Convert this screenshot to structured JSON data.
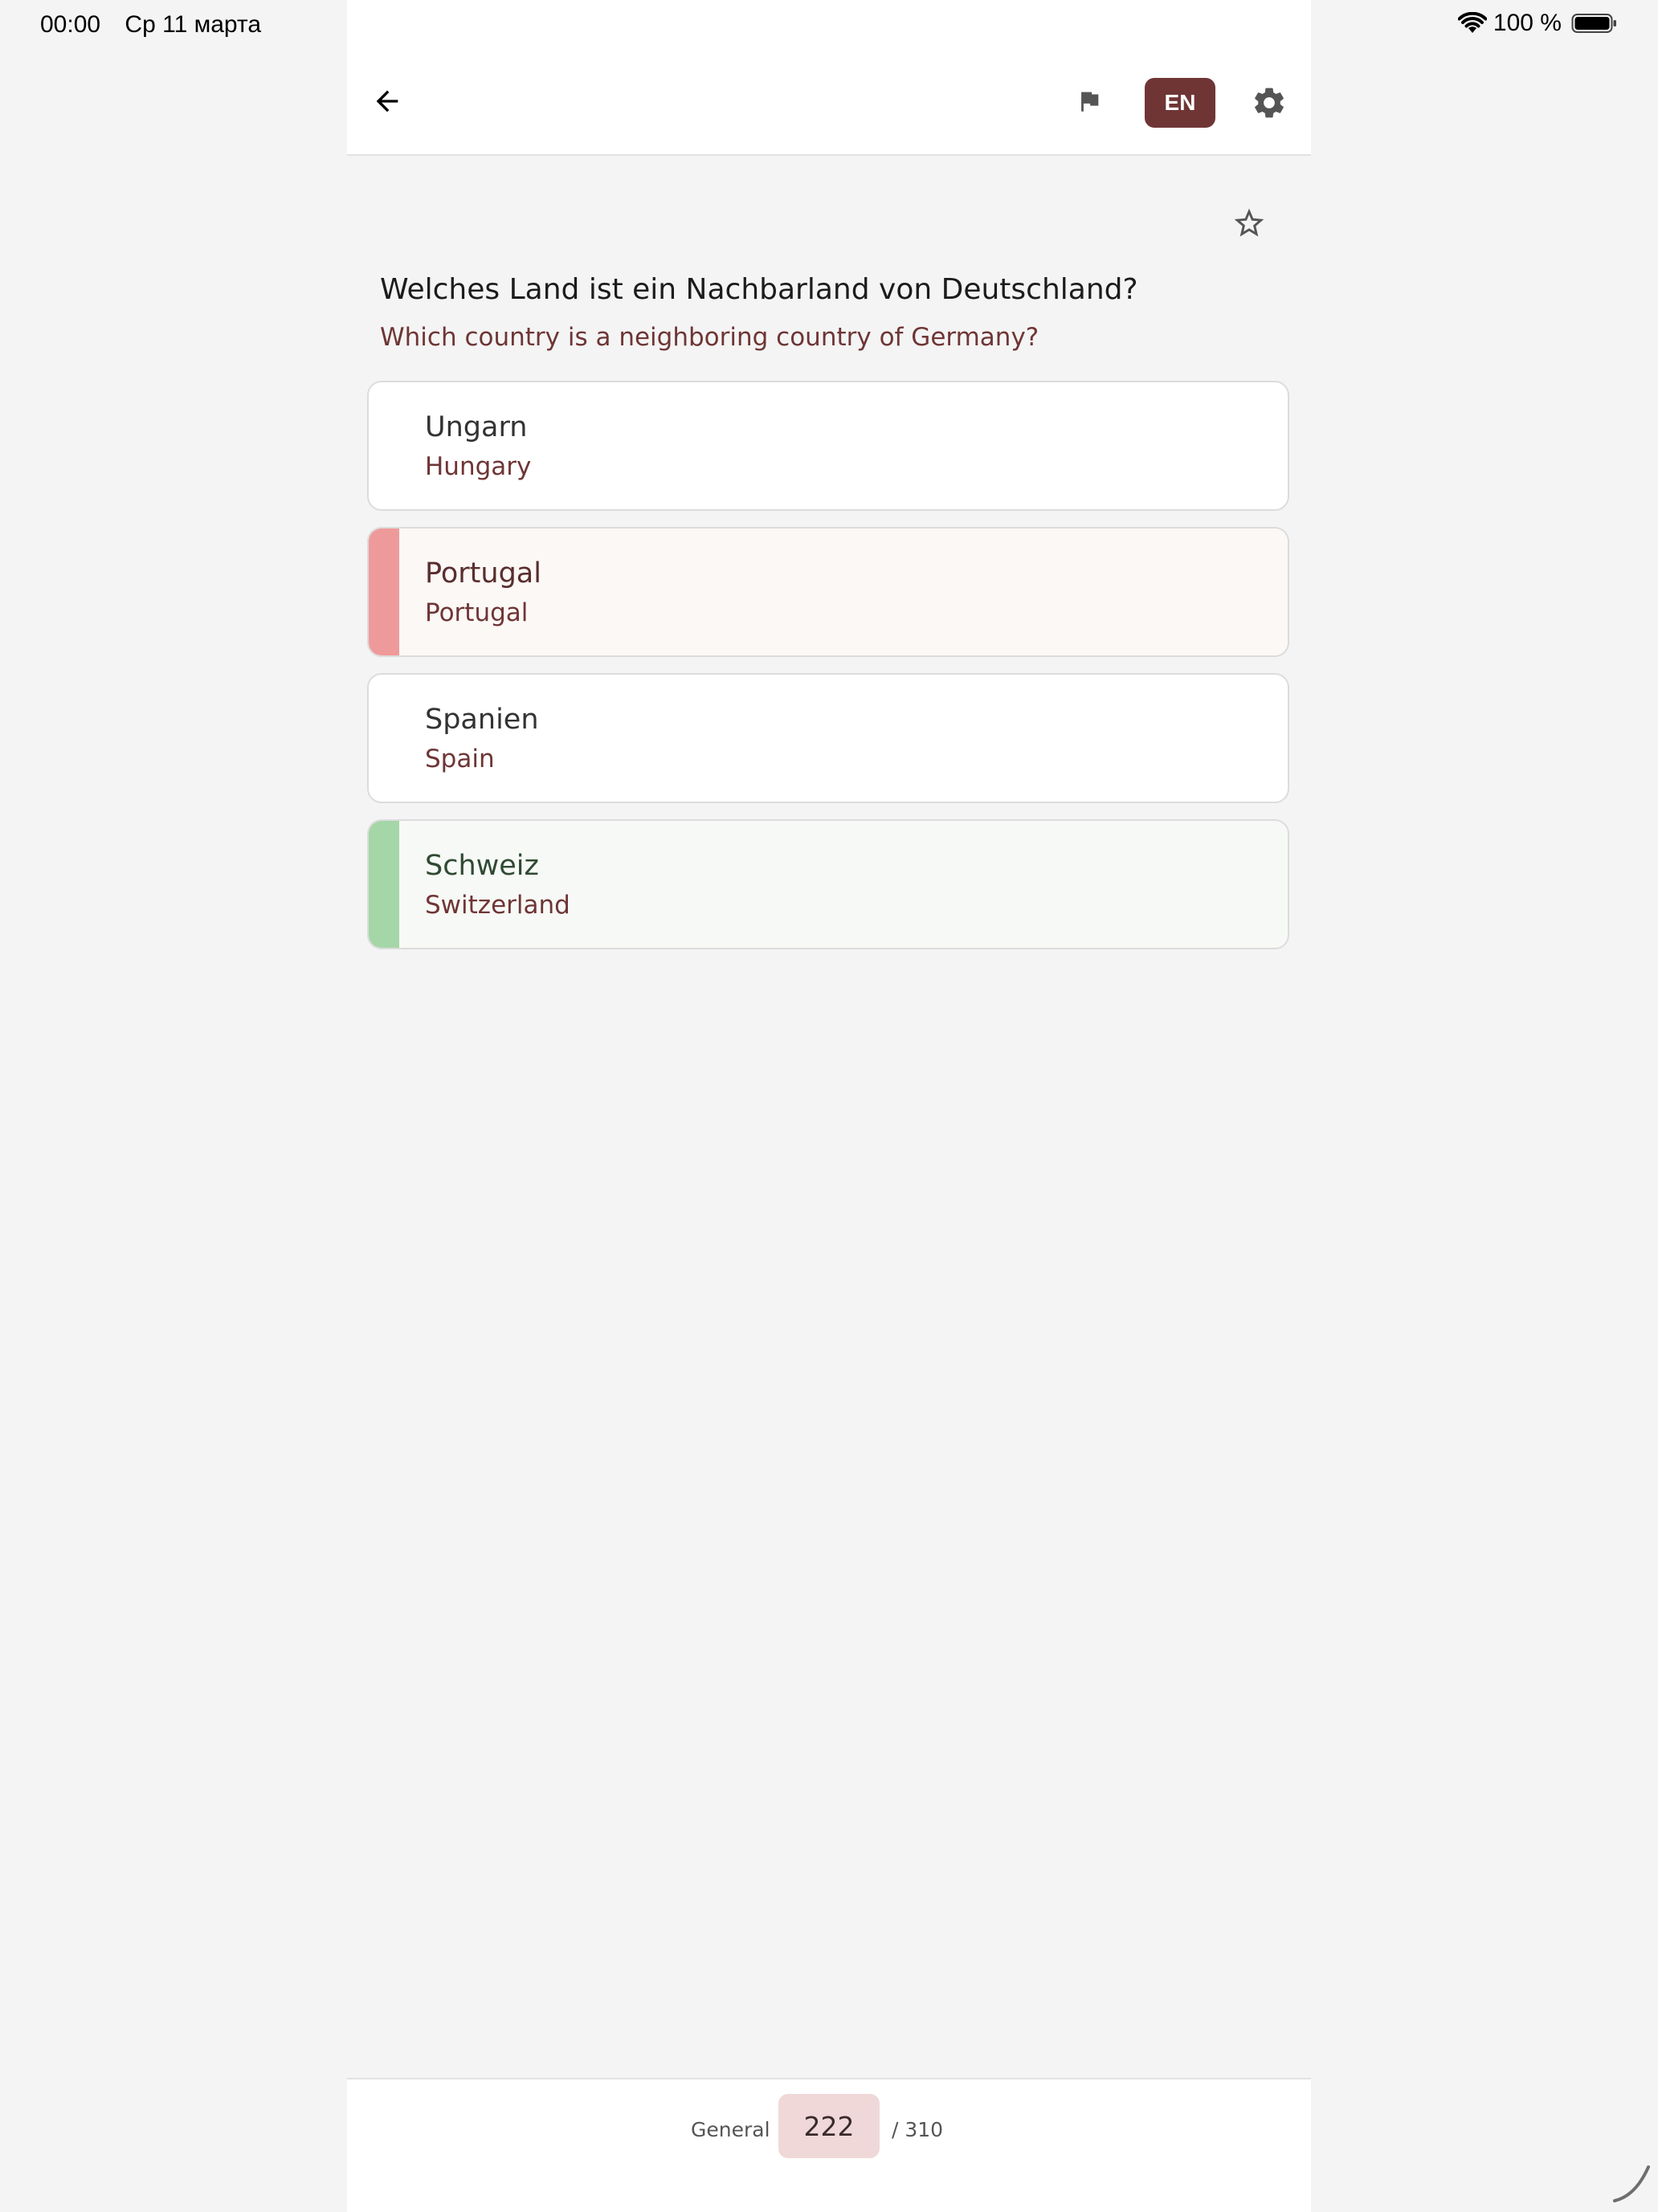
{
  "status_bar": {
    "time": "00:00",
    "date": "Ср 11 марта",
    "battery": "100 %"
  },
  "toolbar": {
    "back_icon": "arrow-left-icon",
    "flag_icon": "flag-icon",
    "language_label": "EN",
    "settings_icon": "gear-icon"
  },
  "question": {
    "favorite_icon": "star-outline-icon",
    "text_de": "Welches Land ist ein Nachbarland von Deutschland?",
    "text_en": "Which country is a neighboring country of Germany?"
  },
  "answers": [
    {
      "de": "Ungarn",
      "en": "Hungary",
      "state": "neutral"
    },
    {
      "de": "Portugal",
      "en": "Portugal",
      "state": "wrong"
    },
    {
      "de": "Spanien",
      "en": "Spain",
      "state": "neutral"
    },
    {
      "de": "Schweiz",
      "en": "Switzerland",
      "state": "correct"
    }
  ],
  "footer": {
    "category": "General",
    "current": "222",
    "total": "/ 310"
  },
  "colors": {
    "accent": "#6f3535",
    "wrong": "#ef9a9a",
    "correct": "#a5d6a7",
    "counter_bg": "#f0d8d8"
  }
}
